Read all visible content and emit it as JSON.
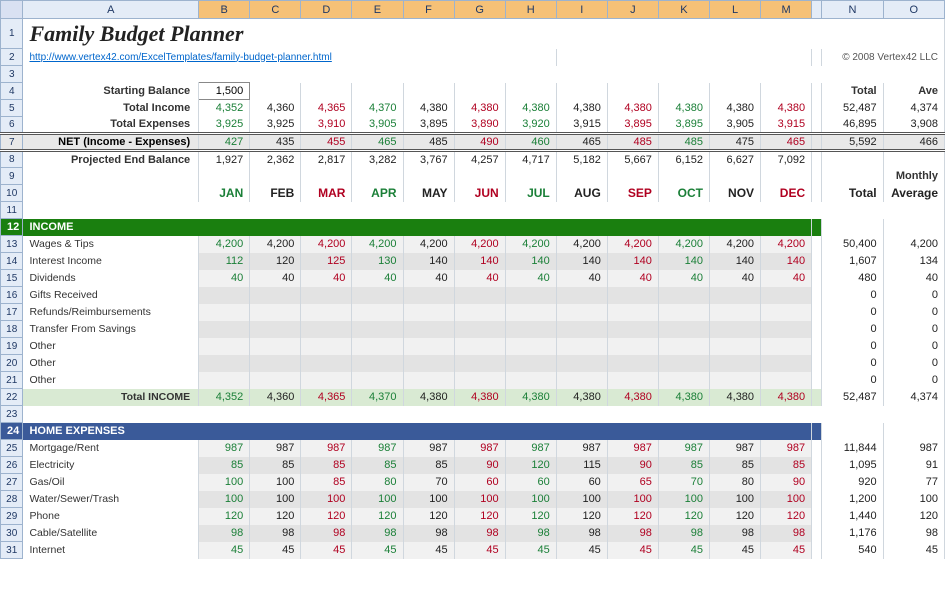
{
  "title": "Family Budget Planner",
  "link": "http://www.vertex42.com/ExcelTemplates/family-budget-planner.html",
  "copyright": "© 2008 Vertex42 LLC",
  "columns": [
    "A",
    "B",
    "C",
    "D",
    "E",
    "F",
    "G",
    "H",
    "I",
    "J",
    "K",
    "L",
    "M",
    "N",
    "O"
  ],
  "selected_cols": [
    "B",
    "C",
    "D",
    "E",
    "F",
    "G",
    "H",
    "I",
    "J",
    "K",
    "L",
    "M"
  ],
  "labels": {
    "starting_balance": "Starting Balance",
    "total_income": "Total Income",
    "total_expenses": "Total Expenses",
    "net": "NET (Income - Expenses)",
    "projected_end": "Projected End Balance",
    "total": "Total",
    "ave": "Ave",
    "monthly": "Monthly",
    "average": "Average",
    "income_section": "INCOME",
    "home_section": "HOME EXPENSES",
    "total_income_row": "Total INCOME"
  },
  "starting_balance": "1,500",
  "months": [
    {
      "abbr": "JAN",
      "cls": "green"
    },
    {
      "abbr": "FEB",
      "cls": "black"
    },
    {
      "abbr": "MAR",
      "cls": "red"
    },
    {
      "abbr": "APR",
      "cls": "green"
    },
    {
      "abbr": "MAY",
      "cls": "black"
    },
    {
      "abbr": "JUN",
      "cls": "red"
    },
    {
      "abbr": "JUL",
      "cls": "green"
    },
    {
      "abbr": "AUG",
      "cls": "black"
    },
    {
      "abbr": "SEP",
      "cls": "red"
    },
    {
      "abbr": "OCT",
      "cls": "green"
    },
    {
      "abbr": "NOV",
      "cls": "black"
    },
    {
      "abbr": "DEC",
      "cls": "red"
    }
  ],
  "summary": {
    "total_income": {
      "vals": [
        "4,352",
        "4,360",
        "4,365",
        "4,370",
        "4,380",
        "4,380",
        "4,380",
        "4,380",
        "4,380",
        "4,380",
        "4,380",
        "4,380"
      ],
      "total": "52,487",
      "ave": "4,374"
    },
    "total_expenses": {
      "vals": [
        "3,925",
        "3,925",
        "3,910",
        "3,905",
        "3,895",
        "3,890",
        "3,920",
        "3,915",
        "3,895",
        "3,895",
        "3,905",
        "3,915"
      ],
      "total": "46,895",
      "ave": "3,908"
    },
    "net": {
      "vals": [
        "427",
        "435",
        "455",
        "465",
        "485",
        "490",
        "460",
        "465",
        "485",
        "485",
        "475",
        "465"
      ],
      "total": "5,592",
      "ave": "466"
    },
    "projected": {
      "vals": [
        "1,927",
        "2,362",
        "2,817",
        "3,282",
        "3,767",
        "4,257",
        "4,717",
        "5,182",
        "5,667",
        "6,152",
        "6,627",
        "7,092"
      ]
    }
  },
  "income_rows": [
    {
      "name": "Wages & Tips",
      "vals": [
        "4,200",
        "4,200",
        "4,200",
        "4,200",
        "4,200",
        "4,200",
        "4,200",
        "4,200",
        "4,200",
        "4,200",
        "4,200",
        "4,200"
      ],
      "total": "50,400",
      "ave": "4,200",
      "band": "A"
    },
    {
      "name": "Interest Income",
      "vals": [
        "112",
        "120",
        "125",
        "130",
        "140",
        "140",
        "140",
        "140",
        "140",
        "140",
        "140",
        "140"
      ],
      "total": "1,607",
      "ave": "134",
      "band": "B"
    },
    {
      "name": "Dividends",
      "vals": [
        "40",
        "40",
        "40",
        "40",
        "40",
        "40",
        "40",
        "40",
        "40",
        "40",
        "40",
        "40"
      ],
      "total": "480",
      "ave": "40",
      "band": "A"
    },
    {
      "name": "Gifts Received",
      "vals": [
        "",
        "",
        "",
        "",
        "",
        "",
        "",
        "",
        "",
        "",
        "",
        ""
      ],
      "total": "0",
      "ave": "0",
      "band": "B"
    },
    {
      "name": "Refunds/Reimbursements",
      "vals": [
        "",
        "",
        "",
        "",
        "",
        "",
        "",
        "",
        "",
        "",
        "",
        ""
      ],
      "total": "0",
      "ave": "0",
      "band": "A"
    },
    {
      "name": "Transfer From Savings",
      "vals": [
        "",
        "",
        "",
        "",
        "",
        "",
        "",
        "",
        "",
        "",
        "",
        ""
      ],
      "total": "0",
      "ave": "0",
      "band": "B"
    },
    {
      "name": "Other",
      "vals": [
        "",
        "",
        "",
        "",
        "",
        "",
        "",
        "",
        "",
        "",
        "",
        ""
      ],
      "total": "0",
      "ave": "0",
      "band": "A"
    },
    {
      "name": "Other",
      "vals": [
        "",
        "",
        "",
        "",
        "",
        "",
        "",
        "",
        "",
        "",
        "",
        ""
      ],
      "total": "0",
      "ave": "0",
      "band": "B"
    },
    {
      "name": "Other",
      "vals": [
        "",
        "",
        "",
        "",
        "",
        "",
        "",
        "",
        "",
        "",
        "",
        ""
      ],
      "total": "0",
      "ave": "0",
      "band": "A"
    }
  ],
  "income_total": {
    "vals": [
      "4,352",
      "4,360",
      "4,365",
      "4,370",
      "4,380",
      "4,380",
      "4,380",
      "4,380",
      "4,380",
      "4,380",
      "4,380",
      "4,380"
    ],
    "total": "52,487",
    "ave": "4,374"
  },
  "home_rows": [
    {
      "name": "Mortgage/Rent",
      "vals": [
        "987",
        "987",
        "987",
        "987",
        "987",
        "987",
        "987",
        "987",
        "987",
        "987",
        "987",
        "987"
      ],
      "total": "11,844",
      "ave": "987",
      "band": "A"
    },
    {
      "name": "Electricity",
      "vals": [
        "85",
        "85",
        "85",
        "85",
        "85",
        "90",
        "120",
        "115",
        "90",
        "85",
        "85",
        "85"
      ],
      "total": "1,095",
      "ave": "91",
      "band": "B"
    },
    {
      "name": "Gas/Oil",
      "vals": [
        "100",
        "100",
        "85",
        "80",
        "70",
        "60",
        "60",
        "60",
        "65",
        "70",
        "80",
        "90"
      ],
      "total": "920",
      "ave": "77",
      "band": "A"
    },
    {
      "name": "Water/Sewer/Trash",
      "vals": [
        "100",
        "100",
        "100",
        "100",
        "100",
        "100",
        "100",
        "100",
        "100",
        "100",
        "100",
        "100"
      ],
      "total": "1,200",
      "ave": "100",
      "band": "B"
    },
    {
      "name": "Phone",
      "vals": [
        "120",
        "120",
        "120",
        "120",
        "120",
        "120",
        "120",
        "120",
        "120",
        "120",
        "120",
        "120"
      ],
      "total": "1,440",
      "ave": "120",
      "band": "A"
    },
    {
      "name": "Cable/Satellite",
      "vals": [
        "98",
        "98",
        "98",
        "98",
        "98",
        "98",
        "98",
        "98",
        "98",
        "98",
        "98",
        "98"
      ],
      "total": "1,176",
      "ave": "98",
      "band": "B"
    },
    {
      "name": "Internet",
      "vals": [
        "45",
        "45",
        "45",
        "45",
        "45",
        "45",
        "45",
        "45",
        "45",
        "45",
        "45",
        "45"
      ],
      "total": "540",
      "ave": "45",
      "band": "A"
    }
  ]
}
